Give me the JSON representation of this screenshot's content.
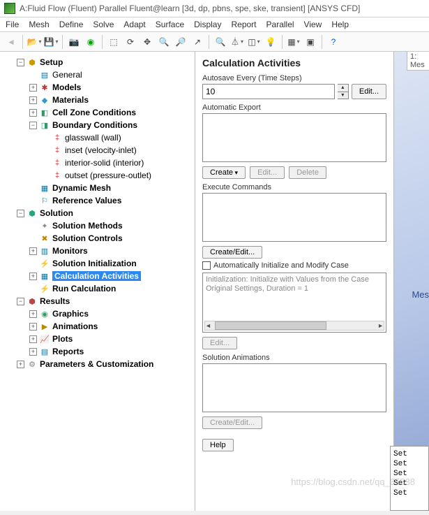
{
  "window": {
    "title": "A:Fluid Flow (Fluent) Parallel Fluent@learn  [3d, dp, pbns, spe, ske, transient] [ANSYS CFD]"
  },
  "menu": [
    "File",
    "Mesh",
    "Define",
    "Solve",
    "Adapt",
    "Surface",
    "Display",
    "Report",
    "Parallel",
    "View",
    "Help"
  ],
  "tree": {
    "setup": {
      "label": "Setup",
      "items": {
        "general": "General",
        "models": "Models",
        "materials": "Materials",
        "cellzone": "Cell Zone Conditions",
        "bc": {
          "label": "Boundary Conditions",
          "children": {
            "glasswall": "glasswall (wall)",
            "inset": "inset (velocity-inlet)",
            "interior": "interior-solid (interior)",
            "outset": "outset (pressure-outlet)"
          }
        },
        "dynmesh": "Dynamic Mesh",
        "refvals": "Reference Values"
      }
    },
    "solution": {
      "label": "Solution",
      "items": {
        "methods": "Solution Methods",
        "controls": "Solution Controls",
        "monitors": "Monitors",
        "init": "Solution Initialization",
        "calc_act": "Calculation Activities",
        "run": "Run Calculation"
      }
    },
    "results": {
      "label": "Results",
      "items": {
        "graphics": "Graphics",
        "animations": "Animations",
        "plots": "Plots",
        "reports": "Reports"
      }
    },
    "params": "Parameters & Customization"
  },
  "task": {
    "title": "Calculation Activities",
    "autosave_label": "Autosave Every (Time Steps)",
    "autosave_value": "10",
    "edit": "Edit...",
    "autoexport_label": "Automatic Export",
    "create": "Create",
    "delete": "Delete",
    "exec_label": "Execute Commands",
    "createedit": "Create/Edit...",
    "autoinit_label": "Automatically Initialize and Modify Case",
    "autoinit_text": "Initialization: Initialize with Values from the Case\nOriginal Settings, Duration = 1",
    "solanim_label": "Solution Animations",
    "help": "Help"
  },
  "right": {
    "tab": "1: Mes",
    "mesh_label": "Mes",
    "console": [
      "Set",
      "Set",
      "Set",
      "Set",
      "Set"
    ]
  },
  "watermark": "https://blog.csdn.net/qq_35538"
}
